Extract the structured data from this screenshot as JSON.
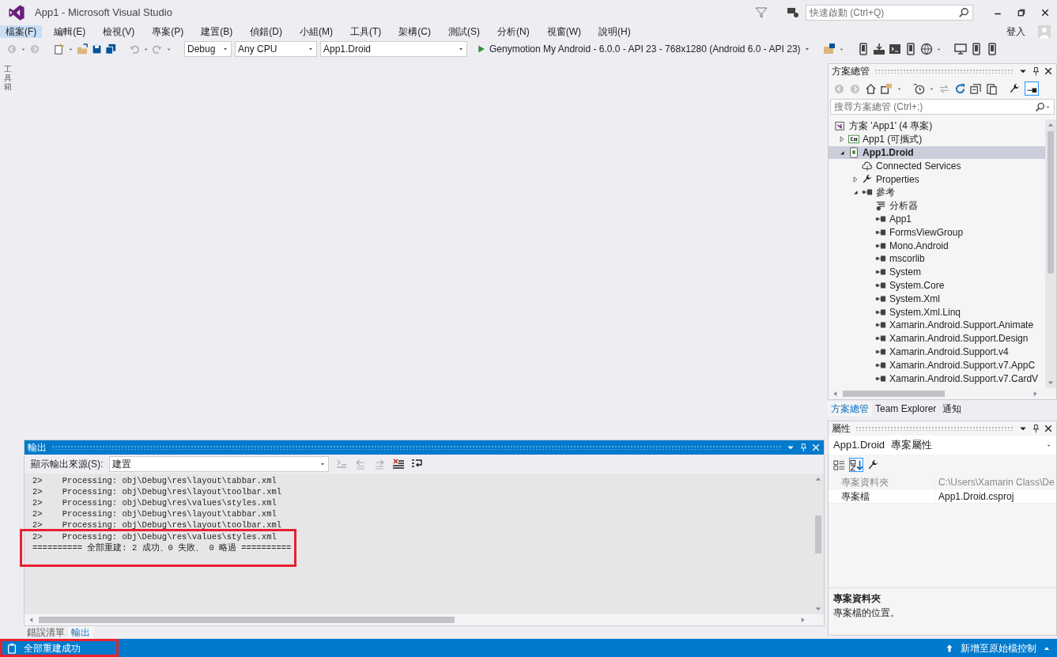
{
  "window": {
    "title": "App1 - Microsoft Visual Studio"
  },
  "quick_launch": {
    "placeholder": "快速啟動 (Ctrl+Q)"
  },
  "menu": [
    {
      "label": "檔案(F)",
      "selected": true
    },
    {
      "label": "編輯(E)",
      "selected": false
    },
    {
      "label": "檢視(V)",
      "selected": false
    },
    {
      "label": "專案(P)",
      "selected": false
    },
    {
      "label": "建置(B)",
      "selected": false
    },
    {
      "label": "偵錯(D)",
      "selected": false
    },
    {
      "label": "小組(M)",
      "selected": false
    },
    {
      "label": "工具(T)",
      "selected": false
    },
    {
      "label": "架構(C)",
      "selected": false
    },
    {
      "label": "測試(S)",
      "selected": false
    },
    {
      "label": "分析(N)",
      "selected": false
    },
    {
      "label": "視窗(W)",
      "selected": false
    },
    {
      "label": "說明(H)",
      "selected": false
    }
  ],
  "account": {
    "label": "登入"
  },
  "toolbar": {
    "configuration": "Debug",
    "platform": "Any CPU",
    "startup_project": "App1.Droid",
    "run_target": "Genymotion My Android - 6.0.0 - API 23 - 768x1280 (Android 6.0 - API 23)"
  },
  "toolbox_tab": {
    "label": "工具箱"
  },
  "output": {
    "title": "輸出",
    "source_label": "顯示輸出來源(S):",
    "source": "建置",
    "lines": [
      "2>    Processing: obj\\Debug\\res\\layout\\tabbar.xml",
      "2>    Processing: obj\\Debug\\res\\layout\\toolbar.xml",
      "2>    Processing: obj\\Debug\\res\\values\\styles.xml",
      "2>    Processing: obj\\Debug\\res\\layout\\tabbar.xml",
      "2>    Processing: obj\\Debug\\res\\layout\\toolbar.xml",
      "2>    Processing: obj\\Debug\\res\\values\\styles.xml",
      "========== 全部重建: 2 成功、0 失敗、 0 略過 =========="
    ],
    "tabs": [
      {
        "label": "錯誤清單",
        "selected": false
      },
      {
        "label": "輸出",
        "selected": true
      }
    ]
  },
  "solution_explorer": {
    "title": "方案總管",
    "search_placeholder": "搜尋方案總管 (Ctrl+;)",
    "tree": [
      {
        "label": "方案 'App1' (4 專案)",
        "kind": "solution",
        "selected": false,
        "children": [
          {
            "label": "App1 (可攜式)",
            "kind": "csharp",
            "expanded": false,
            "selected": false
          },
          {
            "label": "App1.Droid",
            "kind": "android",
            "expanded": true,
            "selected": true,
            "children": [
              {
                "label": "Connected Services",
                "kind": "service",
                "selected": false
              },
              {
                "label": "Properties",
                "kind": "properties",
                "expanded": false,
                "selected": false
              },
              {
                "label": "參考",
                "kind": "references",
                "expanded": true,
                "selected": false,
                "children": [
                  {
                    "label": "分析器",
                    "kind": "analyzer",
                    "selected": false
                  },
                  {
                    "label": "App1",
                    "kind": "reference",
                    "selected": false
                  },
                  {
                    "label": "FormsViewGroup",
                    "kind": "reference",
                    "selected": false
                  },
                  {
                    "label": "Mono.Android",
                    "kind": "reference",
                    "selected": false
                  },
                  {
                    "label": "mscorlib",
                    "kind": "reference",
                    "selected": false
                  },
                  {
                    "label": "System",
                    "kind": "reference",
                    "selected": false
                  },
                  {
                    "label": "System.Core",
                    "kind": "reference",
                    "selected": false
                  },
                  {
                    "label": "System.Xml",
                    "kind": "reference",
                    "selected": false
                  },
                  {
                    "label": "System.Xml.Linq",
                    "kind": "reference",
                    "selected": false
                  },
                  {
                    "label": "Xamarin.Android.Support.Animate",
                    "kind": "reference",
                    "selected": false
                  },
                  {
                    "label": "Xamarin.Android.Support.Design",
                    "kind": "reference",
                    "selected": false
                  },
                  {
                    "label": "Xamarin.Android.Support.v4",
                    "kind": "reference",
                    "selected": false
                  },
                  {
                    "label": "Xamarin.Android.Support.v7.AppC",
                    "kind": "reference",
                    "selected": false
                  },
                  {
                    "label": "Xamarin.Android.Support.v7.CardV",
                    "kind": "reference",
                    "selected": false
                  }
                ]
              }
            ]
          }
        ]
      }
    ],
    "tabs": [
      {
        "label": "方案總管",
        "selected": true
      },
      {
        "label": "Team Explorer",
        "selected": false
      },
      {
        "label": "通知",
        "selected": false
      }
    ]
  },
  "properties": {
    "title": "屬性",
    "object_name": "App1.Droid",
    "object_type": "專案屬性",
    "rows": [
      {
        "name": "專案資料夾",
        "value": "C:\\Users\\Xamarin Class\\De",
        "disabled": true
      },
      {
        "name": "專案檔",
        "value": "App1.Droid.csproj",
        "disabled": false
      }
    ],
    "description_title": "專案資料夾",
    "description": "專案檔的位置。"
  },
  "status_bar": {
    "message": "全部重建成功",
    "source_control": "新增至原始檔控制"
  }
}
